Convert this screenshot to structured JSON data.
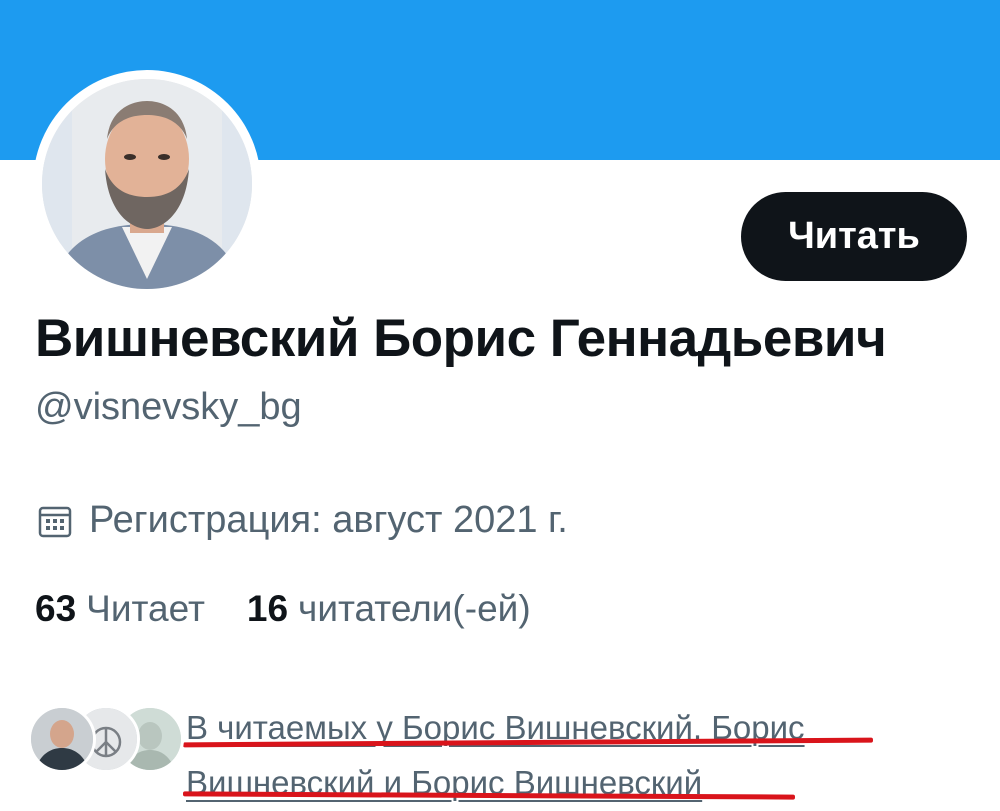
{
  "profile": {
    "banner_color": "#1d9bf0",
    "avatar_alt": "avatar",
    "follow_button_label": "Читать",
    "display_name": "Вишневский Борис Геннадьевич",
    "handle": "@visnevsky_bg",
    "joined_icon": "calendar-icon",
    "joined_text": "Регистрация: август 2021 г."
  },
  "stats": {
    "following_count": "63",
    "following_label": "Читает",
    "followers_count": "16",
    "followers_label": "читатели(-ей)"
  },
  "followed_by": {
    "line1": "В читаемых у Борис Вишневский, Борис",
    "line2": "Вишневский и Борис Вишневский",
    "highlight_color": "#d9141b"
  }
}
